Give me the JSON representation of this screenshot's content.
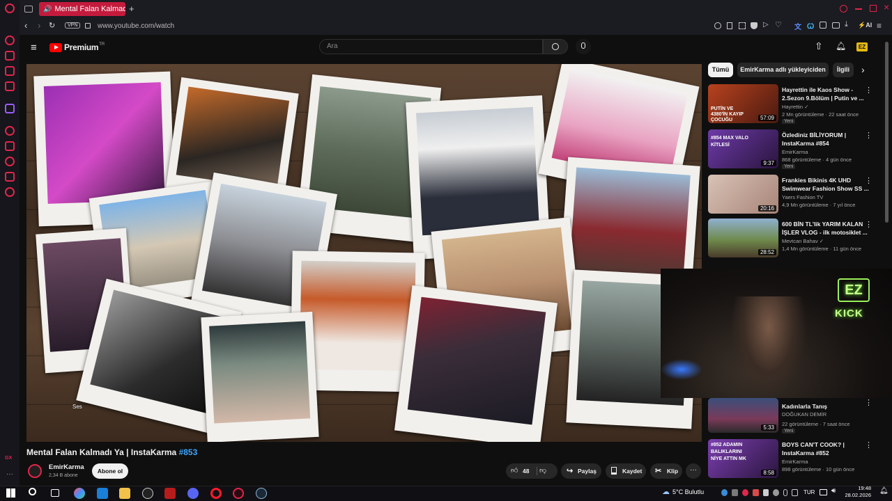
{
  "browser": {
    "tab_title": "Mental Falan Kalmadı Ya",
    "vpn_label": "VPN",
    "url": "www.youtube.com/watch",
    "ai_label": "AI"
  },
  "youtube": {
    "logo_text": "Premium",
    "logo_region": "TR",
    "search_placeholder": "Ara"
  },
  "video": {
    "volume_tooltip": "Ses",
    "title": "Mental Falan Kalmadı Ya | InstaKarma",
    "title_tag": "#853",
    "channel_name": "EmirKarma",
    "subscribers": "2,34 B abone",
    "subscribe_label": "Abone ol",
    "like_count": "48",
    "share_label": "Paylaş",
    "save_label": "Kaydet",
    "clip_label": "Klip"
  },
  "chips": [
    {
      "label": "Tümü"
    },
    {
      "label": "EmirKarma adlı yükleyiciden"
    },
    {
      "label": "İlgili"
    }
  ],
  "recommendations": [
    {
      "title": "Hayrettin ile Kaos Show - 2.Sezon 9.Bölüm | Putin ve ...",
      "channel": "Hayrettin",
      "meta": "2 Mn görüntüleme · 22 saat önce",
      "badge": "Yeni",
      "duration": "57:09",
      "thumb_text": "PUTİN VE 4380'İN KAYIP ÇOCUĞU",
      "color": "#b8421e"
    },
    {
      "title": "Özlediniz BİLİYORUM | InstaKarma #854",
      "channel": "EmirKarma",
      "meta": "868 görüntüleme · 4 gün önce",
      "badge": "Yeni",
      "duration": "9:37",
      "thumb_text": "#854 MAX VALO KİTLESİ",
      "color": "#6d3aa8"
    },
    {
      "title": "Frankies Bikinis 4K UHD Swimwear Fashion Show SS ...",
      "channel": "Yaers Fashion TV",
      "meta": "4,9 Mn görüntüleme · 7 yıl önce",
      "badge": "",
      "duration": "20:16",
      "thumb_text": "",
      "color": "#c9a99a"
    },
    {
      "title": "600 BİN TL'lik YARIM KALAN İŞLER VLOG - ilk motosiklet ...",
      "channel": "Mevtcan Bahav",
      "meta": "1,4 Mn görüntüleme · 11 gün önce",
      "badge": "",
      "duration": "28:52",
      "thumb_text": "",
      "color": "#6f8a4c"
    },
    {
      "title": "Kadınlarla Tanış",
      "channel": "DOĞUKAN DEMİR",
      "meta": "22 görüntüleme · 7 saat önce",
      "badge": "Yeni",
      "duration": "5:33",
      "thumb_text": "",
      "color": "#3b4f7a"
    },
    {
      "title": "BOYS CAN'T COOK? | InstaKarma #852",
      "channel": "EmirKarma",
      "meta": "898 görüntüleme · 10 gün önce",
      "badge": "",
      "duration": "8:58",
      "thumb_text": "#852 ADAMIN BALIKLARINI NİYE ATTIN MK",
      "color": "#7b3fb0"
    }
  ],
  "overlay": {
    "logo_text": "EZ",
    "kick_label": "KICK"
  },
  "taskbar": {
    "weather": "5°C Bulutlu",
    "language": "TUR",
    "time": "19:48",
    "date": "28.02.2026"
  },
  "opera_gx_label": "GX"
}
